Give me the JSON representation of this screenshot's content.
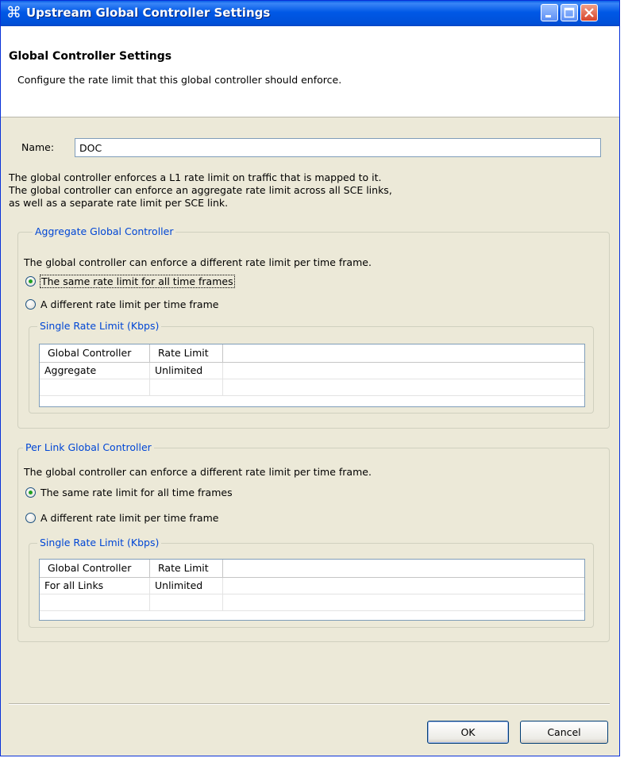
{
  "window": {
    "title": "Upstream Global Controller Settings",
    "app_icon": "cisco-command-icon",
    "buttons": [
      "minimize",
      "maximize",
      "close"
    ]
  },
  "header": {
    "title": "Global Controller Settings",
    "description": "Configure the rate limit that this global controller should enforce."
  },
  "name_field": {
    "label": "Name:",
    "value": "DOC"
  },
  "info": [
    "The global controller enforces a L1 rate limit on traffic that is mapped to it.",
    "The global controller can enforce an aggregate rate limit across all SCE links,",
    "as well as a separate rate limit per SCE link."
  ],
  "aggregate": {
    "legend": "Aggregate Global Controller",
    "description": "The global controller can enforce a different rate limit per time frame.",
    "radio_same": "The same rate limit for all time frames",
    "radio_different": "A different rate limit per time frame",
    "selected": "same",
    "table_legend": "Single Rate Limit (Kbps)",
    "columns": [
      "Global Controller",
      "Rate Limit"
    ],
    "rows": [
      [
        "Aggregate",
        "Unlimited"
      ]
    ]
  },
  "per_link": {
    "legend": "Per Link Global Controller",
    "description": "The global controller can enforce a different rate limit per time frame.",
    "radio_same": "The same rate limit for all time frames",
    "radio_different": "A different rate limit per time frame",
    "selected": "same",
    "table_legend": "Single Rate Limit (Kbps)",
    "columns": [
      "Global Controller",
      "Rate Limit"
    ],
    "rows": [
      [
        "For all Links",
        "Unlimited"
      ]
    ]
  },
  "footer": {
    "ok_label": "OK",
    "cancel_label": "Cancel"
  },
  "colors": {
    "titlebar": "#0058e6",
    "dialog_bg": "#ece9d8",
    "legend_text": "#0046d5"
  }
}
